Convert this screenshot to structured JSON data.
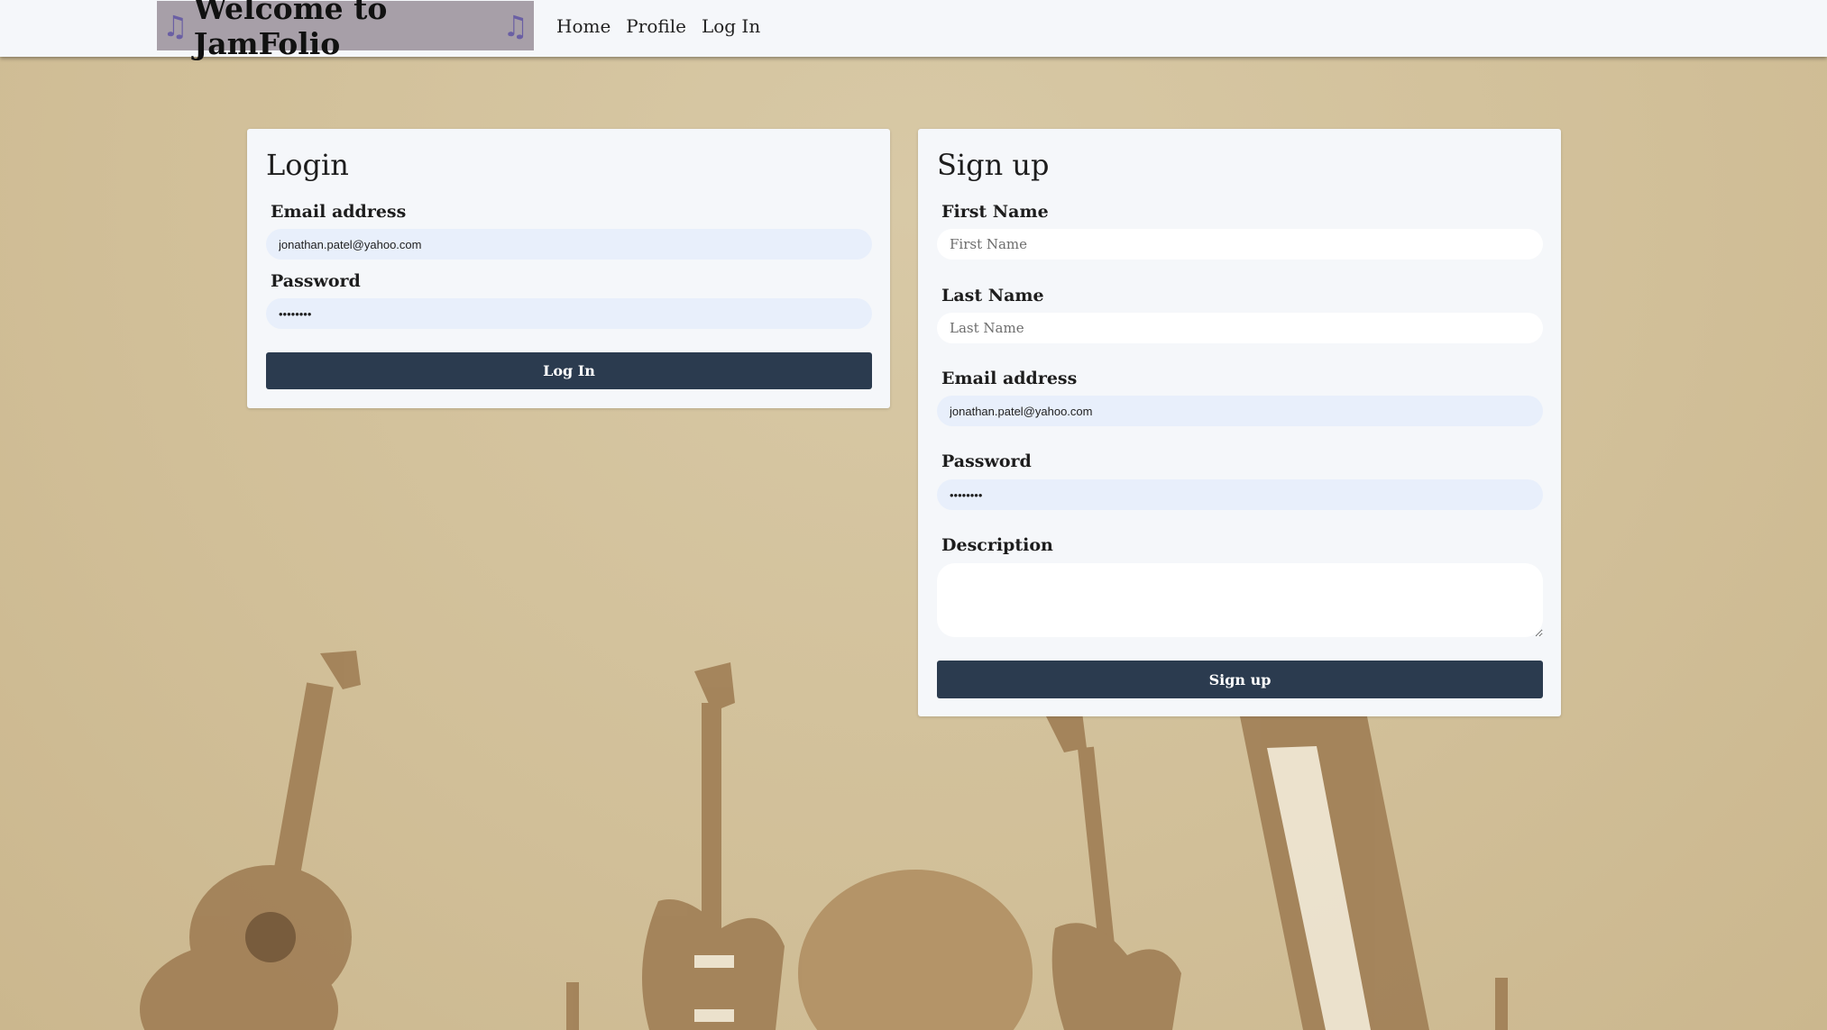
{
  "navbar": {
    "brand": "Welcome to JamFolio",
    "brand_icon": "music-note-icon",
    "links": [
      "Home",
      "Profile",
      "Log In"
    ]
  },
  "login": {
    "title": "Login",
    "email_label": "Email address",
    "email_value": "jonathan.patel@yahoo.com",
    "password_label": "Password",
    "password_value": "12345678",
    "submit_label": "Log In"
  },
  "signup": {
    "title": "Sign up",
    "first_name_label": "First Name",
    "first_name_placeholder": "First Name",
    "last_name_label": "Last Name",
    "last_name_placeholder": "Last Name",
    "email_label": "Email address",
    "email_value": "jonathan.patel@yahoo.com",
    "password_label": "Password",
    "password_value": "12345678",
    "description_label": "Description",
    "submit_label": "Sign up"
  },
  "colors": {
    "navbar_bg": "#f5f7fa",
    "brand_bg": "#a79fa8",
    "brand_note": "#6a5fa4",
    "button_bg": "#2b3b4f",
    "filled_input_bg": "#e8effb",
    "page_bg": "#d4c4a0"
  }
}
